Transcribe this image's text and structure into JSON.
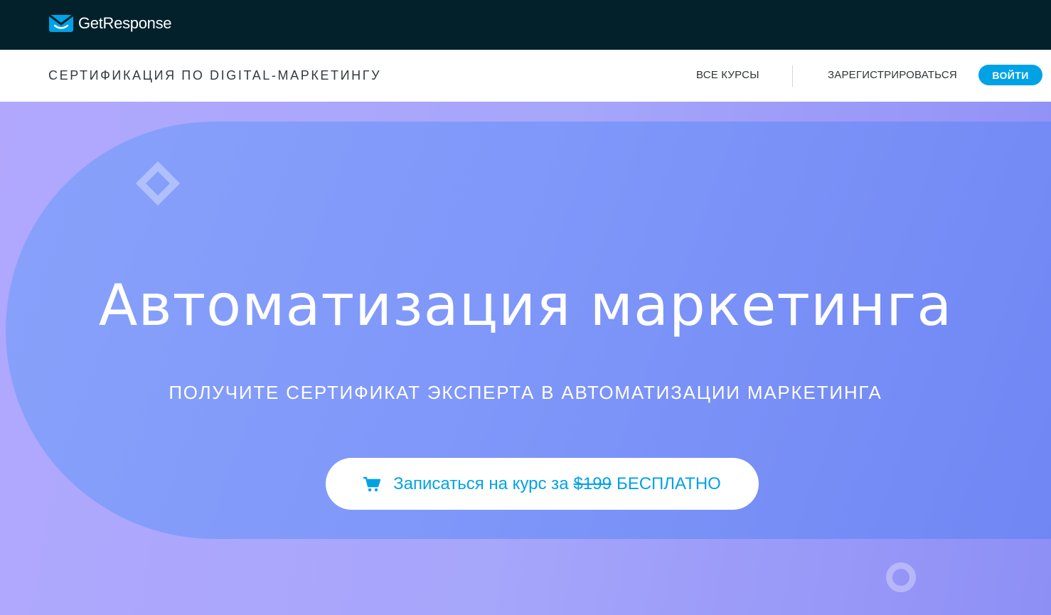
{
  "brand": {
    "name": "GetResponse",
    "color": "#00a2e6",
    "logo_icon": "envelope-smile-icon"
  },
  "nav": {
    "title": "СЕРТИФИКАЦИЯ ПО DIGITAL-МАРКЕТИНГУ",
    "all_courses": "ВСЕ КУРСЫ",
    "register": "ЗАРЕГИСТРИРОВАТЬСЯ",
    "login": "ВОЙТИ"
  },
  "hero": {
    "title": "Автоматизация маркетинга",
    "subtitle": "ПОЛУЧИТЕ СЕРТИФИКАТ ЭКСПЕРТА В АВТОМАТИЗАЦИИ МАРКЕТИНГА",
    "cta": {
      "icon": "shopping-cart-icon",
      "prefix": "Записаться на курс за",
      "old_price": "$199",
      "free_label": "БЕСПЛАТНО"
    }
  },
  "colors": {
    "topbar": "#02212b",
    "accent": "#00a2e6",
    "hero_background": "#a6a6fb",
    "hero_band": "#7f97f9"
  }
}
